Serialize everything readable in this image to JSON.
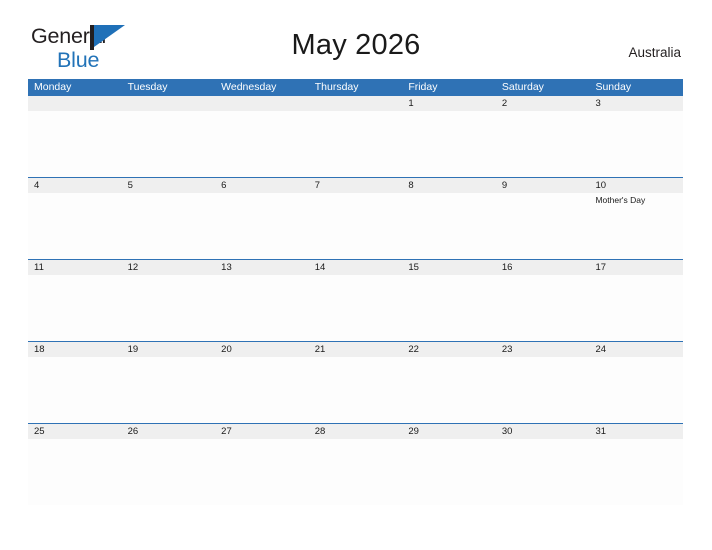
{
  "brand": {
    "name_part1": "General",
    "name_part2": "Blue",
    "flag_icon": "flag-triangle-icon"
  },
  "header": {
    "title": "May 2026",
    "country": "Australia"
  },
  "calendar": {
    "weekday_headers": [
      "Monday",
      "Tuesday",
      "Wednesday",
      "Thursday",
      "Friday",
      "Saturday",
      "Sunday"
    ],
    "accent_color": "#2f72b5",
    "date_band_color": "#efefef",
    "weeks": [
      {
        "days": [
          {
            "num": "",
            "event": ""
          },
          {
            "num": "",
            "event": ""
          },
          {
            "num": "",
            "event": ""
          },
          {
            "num": "",
            "event": ""
          },
          {
            "num": "1",
            "event": ""
          },
          {
            "num": "2",
            "event": ""
          },
          {
            "num": "3",
            "event": ""
          }
        ]
      },
      {
        "days": [
          {
            "num": "4",
            "event": ""
          },
          {
            "num": "5",
            "event": ""
          },
          {
            "num": "6",
            "event": ""
          },
          {
            "num": "7",
            "event": ""
          },
          {
            "num": "8",
            "event": ""
          },
          {
            "num": "9",
            "event": ""
          },
          {
            "num": "10",
            "event": "Mother's Day"
          }
        ]
      },
      {
        "days": [
          {
            "num": "11",
            "event": ""
          },
          {
            "num": "12",
            "event": ""
          },
          {
            "num": "13",
            "event": ""
          },
          {
            "num": "14",
            "event": ""
          },
          {
            "num": "15",
            "event": ""
          },
          {
            "num": "16",
            "event": ""
          },
          {
            "num": "17",
            "event": ""
          }
        ]
      },
      {
        "days": [
          {
            "num": "18",
            "event": ""
          },
          {
            "num": "19",
            "event": ""
          },
          {
            "num": "20",
            "event": ""
          },
          {
            "num": "21",
            "event": ""
          },
          {
            "num": "22",
            "event": ""
          },
          {
            "num": "23",
            "event": ""
          },
          {
            "num": "24",
            "event": ""
          }
        ]
      },
      {
        "days": [
          {
            "num": "25",
            "event": ""
          },
          {
            "num": "26",
            "event": ""
          },
          {
            "num": "27",
            "event": ""
          },
          {
            "num": "28",
            "event": ""
          },
          {
            "num": "29",
            "event": ""
          },
          {
            "num": "30",
            "event": ""
          },
          {
            "num": "31",
            "event": ""
          }
        ]
      }
    ]
  }
}
